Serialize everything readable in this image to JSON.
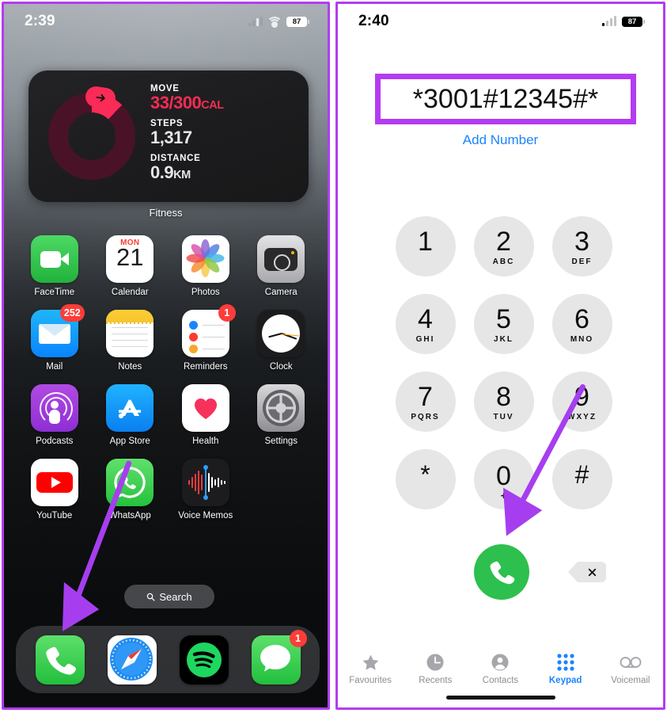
{
  "left_phone": {
    "status_bar": {
      "time": "2:39",
      "battery": "87",
      "wifi_icon": "wifi-icon",
      "signal_icon": "cellular-signal-icon"
    },
    "widget": {
      "app_name": "Fitness",
      "move_label": "MOVE",
      "move_value": "33/300",
      "move_unit": "CAL",
      "steps_label": "STEPS",
      "steps_value": "1,317",
      "distance_label": "DISTANCE",
      "distance_value": "0.9",
      "distance_unit": "KM",
      "ring_color": "#fa2b56",
      "ring_track_color": "#4a1226",
      "ring_progress_pct": 11
    },
    "apps": [
      {
        "label": "FaceTime",
        "icon": "facetime-icon",
        "badge": null
      },
      {
        "label": "Calendar",
        "icon": "calendar-icon",
        "badge": null,
        "weekday": "MON",
        "day": "21"
      },
      {
        "label": "Photos",
        "icon": "photos-icon",
        "badge": null
      },
      {
        "label": "Camera",
        "icon": "camera-icon",
        "badge": null
      },
      {
        "label": "Mail",
        "icon": "mail-icon",
        "badge": "252"
      },
      {
        "label": "Notes",
        "icon": "notes-icon",
        "badge": null
      },
      {
        "label": "Reminders",
        "icon": "reminders-icon",
        "badge": "1"
      },
      {
        "label": "Clock",
        "icon": "clock-icon",
        "badge": null
      },
      {
        "label": "Podcasts",
        "icon": "podcasts-icon",
        "badge": null
      },
      {
        "label": "App Store",
        "icon": "app-store-icon",
        "badge": null
      },
      {
        "label": "Health",
        "icon": "health-icon",
        "badge": null
      },
      {
        "label": "Settings",
        "icon": "settings-icon",
        "badge": null
      },
      {
        "label": "YouTube",
        "icon": "youtube-icon",
        "badge": null
      },
      {
        "label": "WhatsApp",
        "icon": "whatsapp-icon",
        "badge": null
      },
      {
        "label": "Voice Memos",
        "icon": "voice-memos-icon",
        "badge": null
      }
    ],
    "search": {
      "label": "Search",
      "icon": "search-icon"
    },
    "dock": [
      {
        "label": "Phone",
        "icon": "phone-icon",
        "badge": null
      },
      {
        "label": "Safari",
        "icon": "safari-icon",
        "badge": null
      },
      {
        "label": "Spotify",
        "icon": "spotify-icon",
        "badge": null
      },
      {
        "label": "Messages",
        "icon": "messages-icon",
        "badge": "1"
      }
    ],
    "annotation_arrow": {
      "color": "#a63ef0",
      "points_to": "Phone app in dock"
    }
  },
  "right_phone": {
    "status_bar": {
      "time": "2:40",
      "battery": "87",
      "signal_icon": "cellular-signal-icon"
    },
    "dialer": {
      "number": "*3001#12345#*",
      "add_number_label": "Add Number",
      "highlight_color": "#b43cf0",
      "link_color": "#1a84ff"
    },
    "keys": [
      {
        "digit": "1",
        "letters": ""
      },
      {
        "digit": "2",
        "letters": "ABC"
      },
      {
        "digit": "3",
        "letters": "DEF"
      },
      {
        "digit": "4",
        "letters": "GHI"
      },
      {
        "digit": "5",
        "letters": "JKL"
      },
      {
        "digit": "6",
        "letters": "MNO"
      },
      {
        "digit": "7",
        "letters": "PQRS"
      },
      {
        "digit": "8",
        "letters": "TUV"
      },
      {
        "digit": "9",
        "letters": "WXYZ"
      },
      {
        "digit": "*",
        "letters": ""
      },
      {
        "digit": "0",
        "letters": "+"
      },
      {
        "digit": "#",
        "letters": ""
      }
    ],
    "call_button": {
      "icon": "phone-call-icon",
      "color": "#2dc04e"
    },
    "delete_button": {
      "icon": "backspace-delete-icon"
    },
    "tabs": [
      {
        "label": "Favourites",
        "icon": "star-icon",
        "active": false
      },
      {
        "label": "Recents",
        "icon": "clock-icon",
        "active": false
      },
      {
        "label": "Contacts",
        "icon": "person-icon",
        "active": false
      },
      {
        "label": "Keypad",
        "icon": "keypad-grid-icon",
        "active": true
      },
      {
        "label": "Voicemail",
        "icon": "voicemail-icon",
        "active": false
      }
    ],
    "annotation_arrow": {
      "color": "#a63ef0",
      "points_to": "Green call button"
    }
  }
}
